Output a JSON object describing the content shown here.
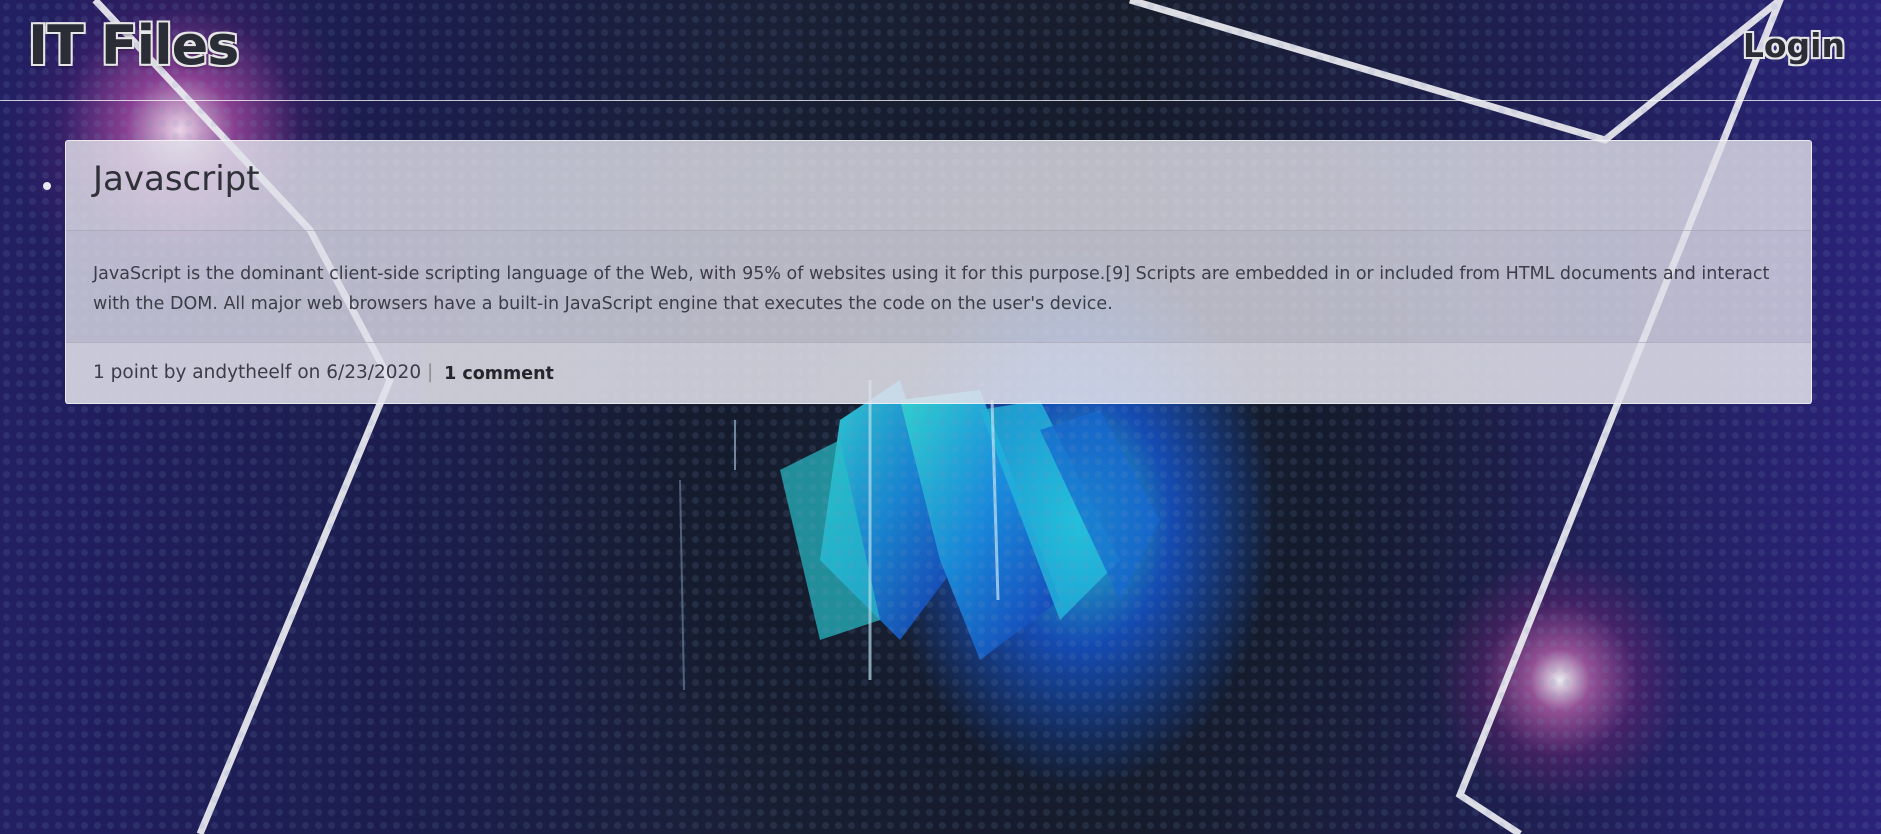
{
  "header": {
    "site_title": "IT Files",
    "login_label": "Login"
  },
  "posts": [
    {
      "title": "Javascript",
      "body": "JavaScript is the dominant client-side scripting language of the Web, with 95% of websites using it for this purpose.[9] Scripts are embedded in or included from HTML documents and interact with the DOM. All major web browsers have a built-in JavaScript engine that executes the code on the user's device.",
      "meta": "1 point by andytheelf on 6/23/2020 |",
      "comments_label": "1 comment"
    }
  ],
  "colors": {
    "card_background": "#dedee8",
    "text": "#3b3d48",
    "title_text": "#2a2d36",
    "outline": "#e6e6e6"
  }
}
